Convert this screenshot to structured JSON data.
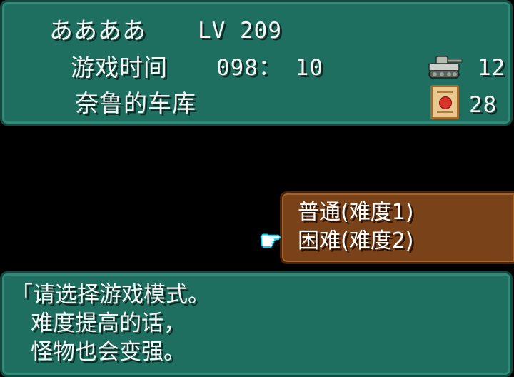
{
  "status": {
    "player_name": "ああああ",
    "level": "LV 209",
    "playtime_label": "游戏时间",
    "playtime_value": "098： 10",
    "location": "奈鲁的车库",
    "tank_count": "12",
    "item_count": "28"
  },
  "menu": {
    "items": [
      {
        "label": "普通(难度1)"
      },
      {
        "label": "困难(难度2)"
      }
    ],
    "selected_index": 1
  },
  "message": {
    "lines": [
      "「请选择游戏模式。",
      "难度提高的话，",
      "怪物也会变强。"
    ]
  },
  "icons": {
    "tank": "tank-icon",
    "item": "treasure-card-icon",
    "cursor": "pointing-hand-icon"
  },
  "colors": {
    "panel_teal": "#1e6f5f",
    "menu_brown": "#7a4219",
    "background": "#000000",
    "cursor_outline": "#00d0ff"
  }
}
